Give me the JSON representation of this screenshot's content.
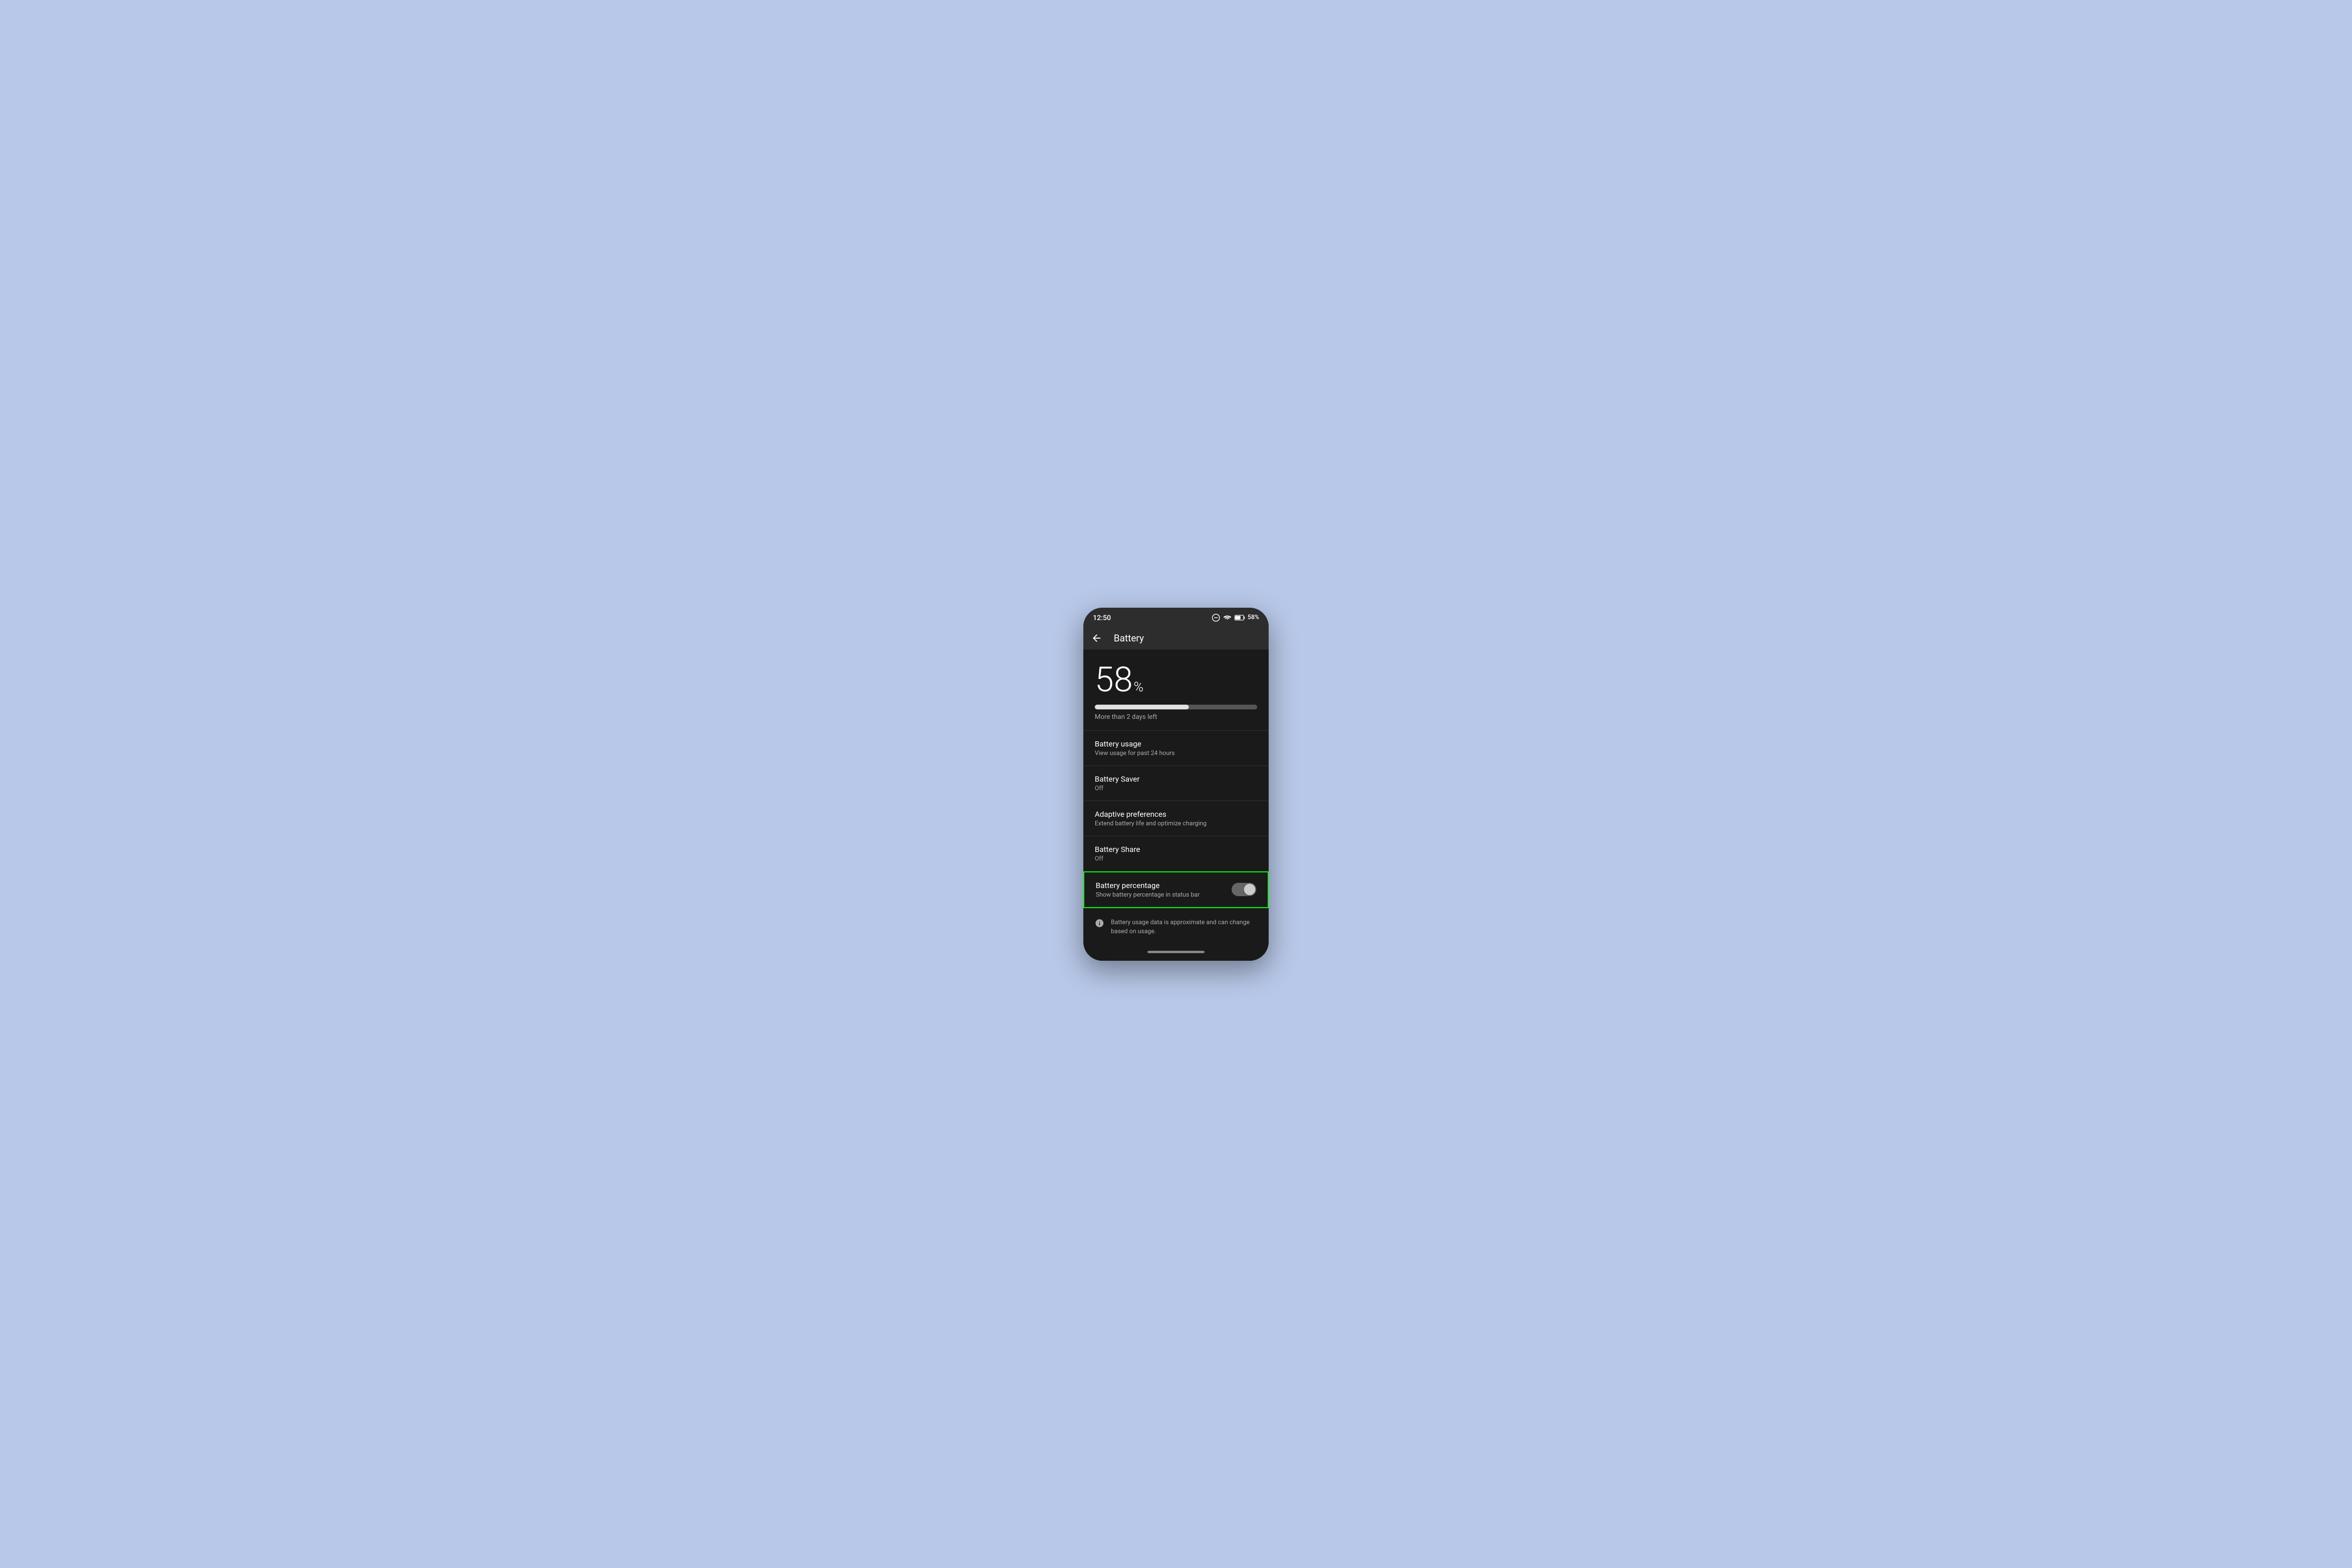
{
  "status_bar": {
    "time": "12:50",
    "battery_percent": "58%"
  },
  "toolbar": {
    "title": "Battery",
    "back_label": "back"
  },
  "battery_hero": {
    "percent_value": "58",
    "percent_sign": "%",
    "bar_fill_percent": 58,
    "time_left": "More than 2 days left"
  },
  "settings_items": [
    {
      "title": "Battery usage",
      "subtitle": "View usage for past 24 hours"
    },
    {
      "title": "Battery Saver",
      "subtitle": "Off"
    },
    {
      "title": "Adaptive preferences",
      "subtitle": "Extend battery life and optimize charging"
    },
    {
      "title": "Battery Share",
      "subtitle": "Off"
    }
  ],
  "battery_percentage_item": {
    "title": "Battery percentage",
    "subtitle": "Show battery percentage in status bar",
    "toggle_state": "on"
  },
  "info_section": {
    "text": "Battery usage data is approximate and can change based on usage."
  }
}
